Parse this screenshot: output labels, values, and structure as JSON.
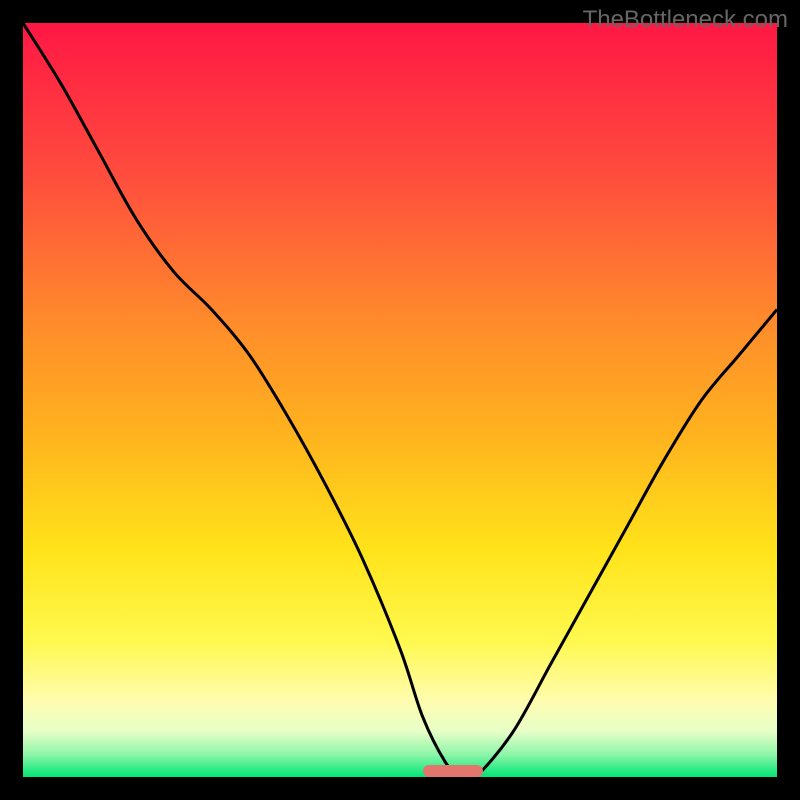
{
  "watermark": "TheBottleneck.com",
  "chart_data": {
    "type": "line",
    "title": "",
    "xlabel": "",
    "ylabel": "",
    "x_range": [
      0,
      100
    ],
    "y_range": [
      0,
      100
    ],
    "series": [
      {
        "name": "bottleneck-curve",
        "x": [
          0,
          5,
          10,
          15,
          20,
          25,
          30,
          35,
          40,
          45,
          50,
          53,
          56,
          58,
          60,
          65,
          70,
          75,
          80,
          85,
          90,
          95,
          100
        ],
        "y": [
          100,
          92,
          83,
          74,
          67,
          62,
          56,
          48,
          39,
          29,
          17,
          8,
          2,
          0,
          0,
          6,
          15,
          24,
          33,
          42,
          50,
          56,
          62
        ]
      }
    ],
    "optimal_marker": {
      "x_start": 53,
      "x_end": 61,
      "y": 0
    },
    "gradient_stops": [
      {
        "offset": 0,
        "color": "#ff1744"
      },
      {
        "offset": 20,
        "color": "#ff4c3e"
      },
      {
        "offset": 40,
        "color": "#ff8c2b"
      },
      {
        "offset": 55,
        "color": "#ffb41e"
      },
      {
        "offset": 70,
        "color": "#ffe31a"
      },
      {
        "offset": 82,
        "color": "#fff94f"
      },
      {
        "offset": 90,
        "color": "#fffcb0"
      },
      {
        "offset": 94,
        "color": "#e6ffc8"
      },
      {
        "offset": 97,
        "color": "#8ef5a8"
      },
      {
        "offset": 100,
        "color": "#00e676"
      }
    ]
  }
}
